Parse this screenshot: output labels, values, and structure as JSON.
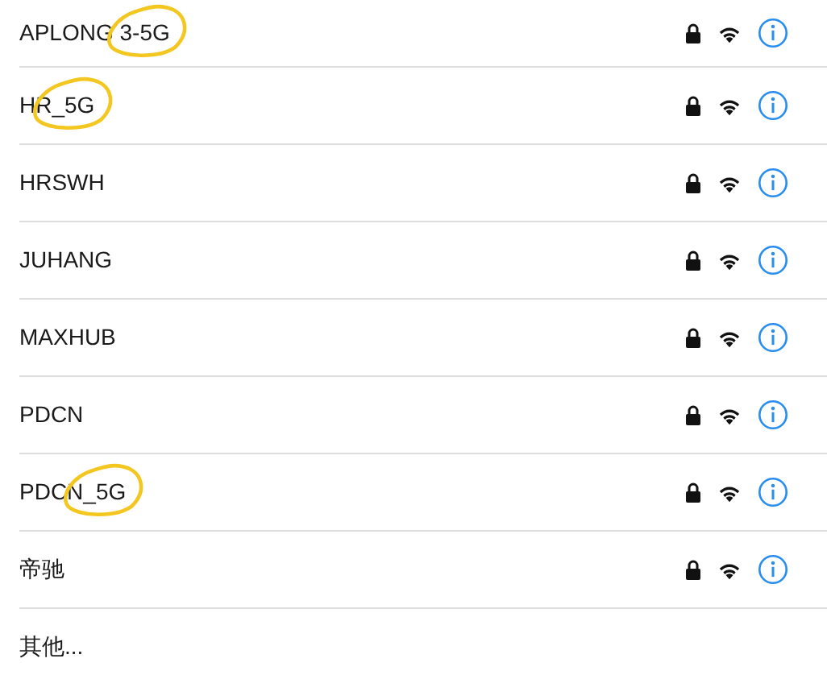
{
  "networks": [
    {
      "name": "APLONG 3-5G",
      "secured": true,
      "circled": true
    },
    {
      "name": "HR_5G",
      "secured": true,
      "circled": true
    },
    {
      "name": "HRSWH",
      "secured": true,
      "circled": false
    },
    {
      "name": "JUHANG",
      "secured": true,
      "circled": false
    },
    {
      "name": "MAXHUB",
      "secured": true,
      "circled": false
    },
    {
      "name": "PDCN",
      "secured": true,
      "circled": false
    },
    {
      "name": "PDCN_5G",
      "secured": true,
      "circled": true
    },
    {
      "name": "帝驰",
      "secured": true,
      "circled": false
    }
  ],
  "other_label": "其他..."
}
